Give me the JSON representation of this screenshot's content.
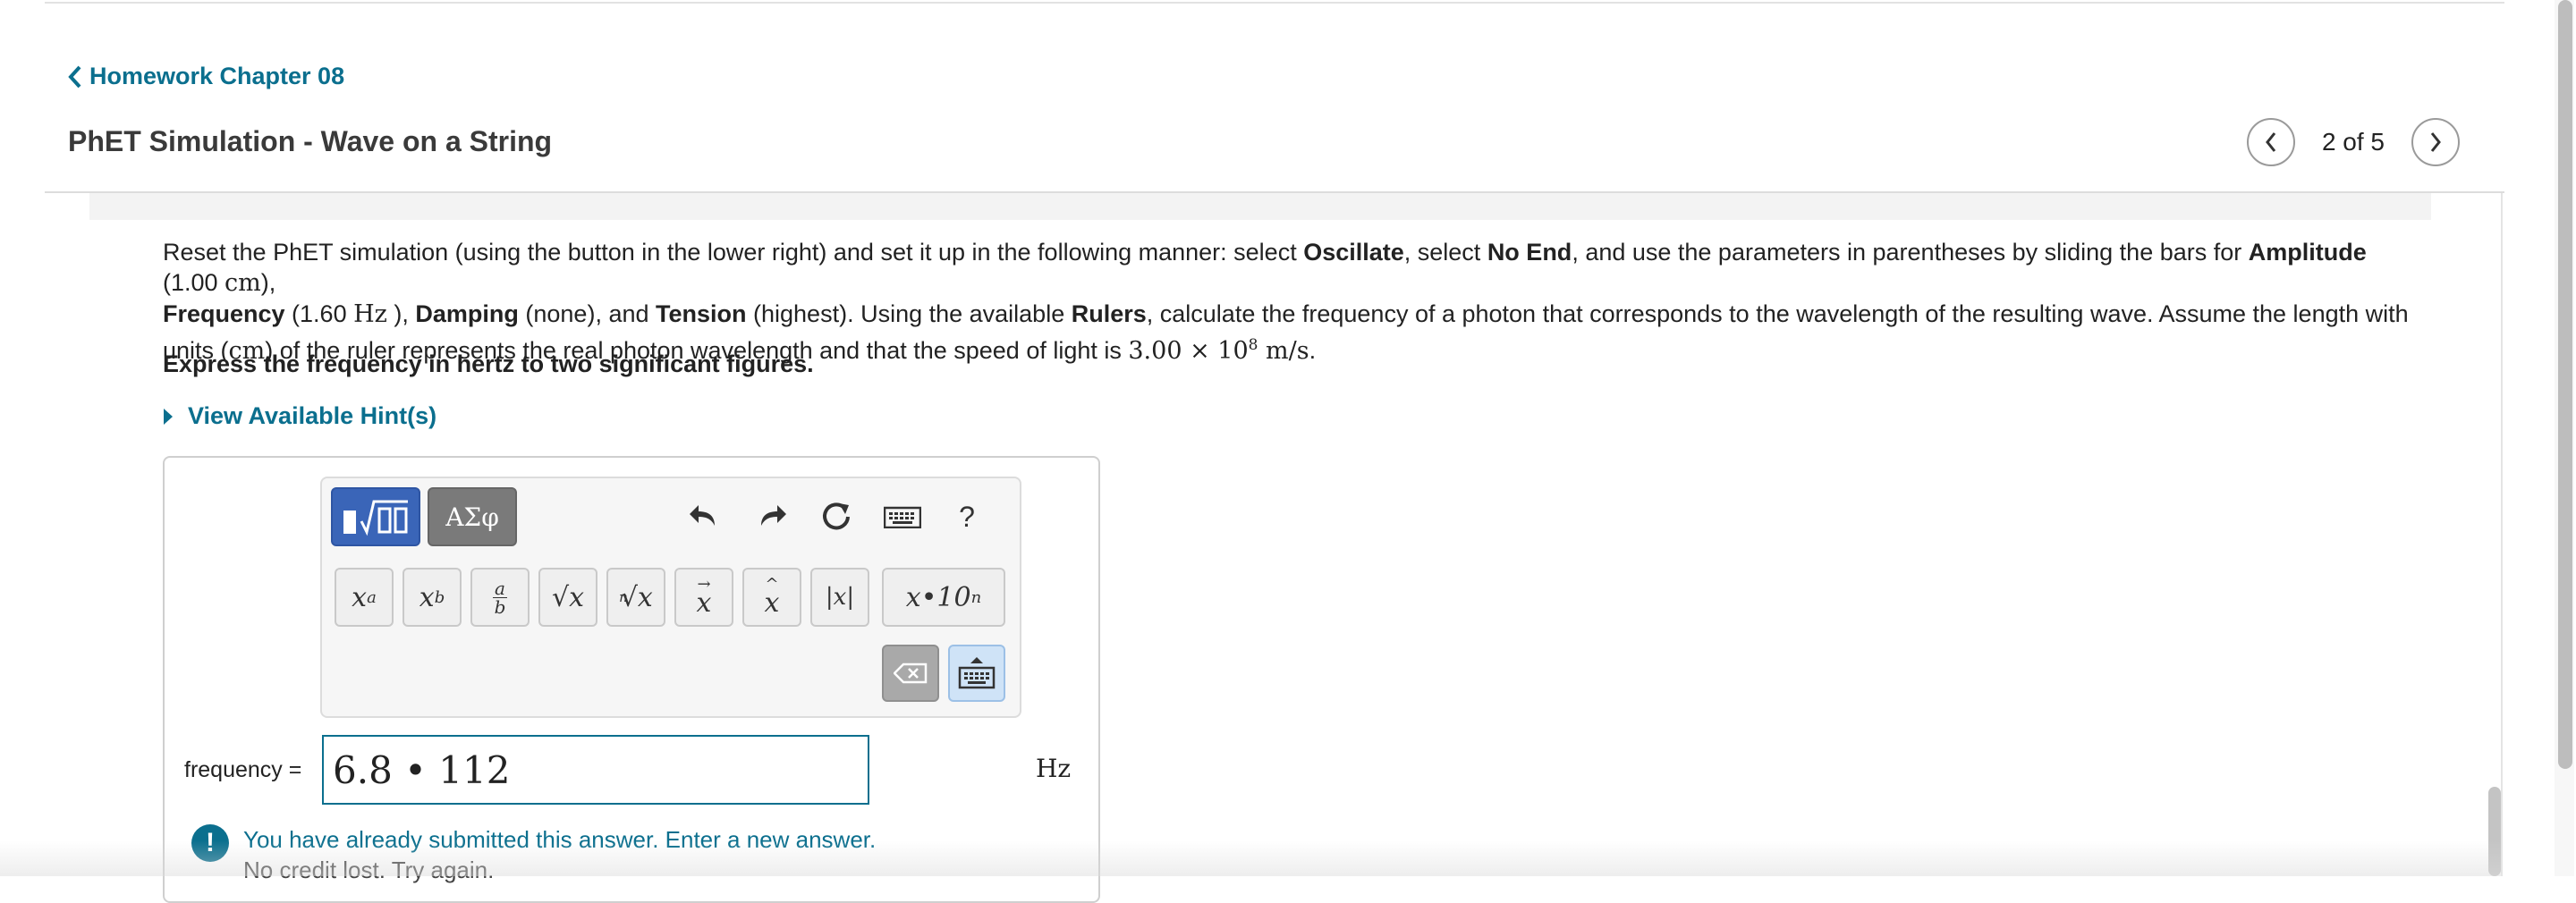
{
  "nav": {
    "back_label": "Homework Chapter 08",
    "title": "PhET Simulation - Wave on a String",
    "pager": "2 of 5"
  },
  "problem": {
    "t1": "Reset the PhET simulation (using the button in the lower right) and set it up in the following manner: select ",
    "oscillate": "Oscillate",
    "t2": ", select ",
    "no_end": "No End",
    "t3": ", and use the parameters in parentheses by sliding the bars for ",
    "amplitude": "Amplitude",
    "t4": " (1.00 ",
    "cm1": "cm",
    "t5": "),",
    "frequency": "Frequency",
    "t6": " (1.60 ",
    "hz": "Hz",
    "t7": " ), ",
    "damping": "Damping",
    "t8": " (none), and ",
    "tension": "Tension",
    "t9": " (highest). Using the available ",
    "rulers": "Rulers",
    "t10": ", calculate the frequency of a photon that corresponds to the wavelength of the resulting wave. Assume the length with units (",
    "cm2": "cm",
    "t11": ") of the ruler represents the real photon wavelength and that the speed of light is ",
    "speed_mantissa": "3.00 × 10",
    "speed_exp": "8",
    "speed_unit": " m/s",
    "t12": "."
  },
  "instruction": "Express the frequency in hertz to two significant figures.",
  "hint_label": "View Available Hint(s)",
  "toolbar": {
    "greek_label": "ΑΣφ",
    "help_label": "?",
    "keys": {
      "power_base": "x",
      "power_sup": "a",
      "sub_base": "x",
      "sub_sub": "b",
      "frac_num": "a",
      "frac_den": "b",
      "sqrt_label": "√x",
      "nroot_index": "n",
      "nroot_label": "√x",
      "vec_label": "x",
      "hat_label": "x",
      "abs_label": "|x|",
      "sci_label": "x•10",
      "sci_sup": "n"
    }
  },
  "answer": {
    "label": "frequency =",
    "value": "6.8 • 112",
    "unit": "Hz"
  },
  "feedback": {
    "icon": "!",
    "message": "You have already submitted this answer. Enter a new answer.",
    "sub": "No credit lost. Try again."
  },
  "colors": {
    "link": "#0b6f8e",
    "active_mode": "#3a65b8"
  }
}
